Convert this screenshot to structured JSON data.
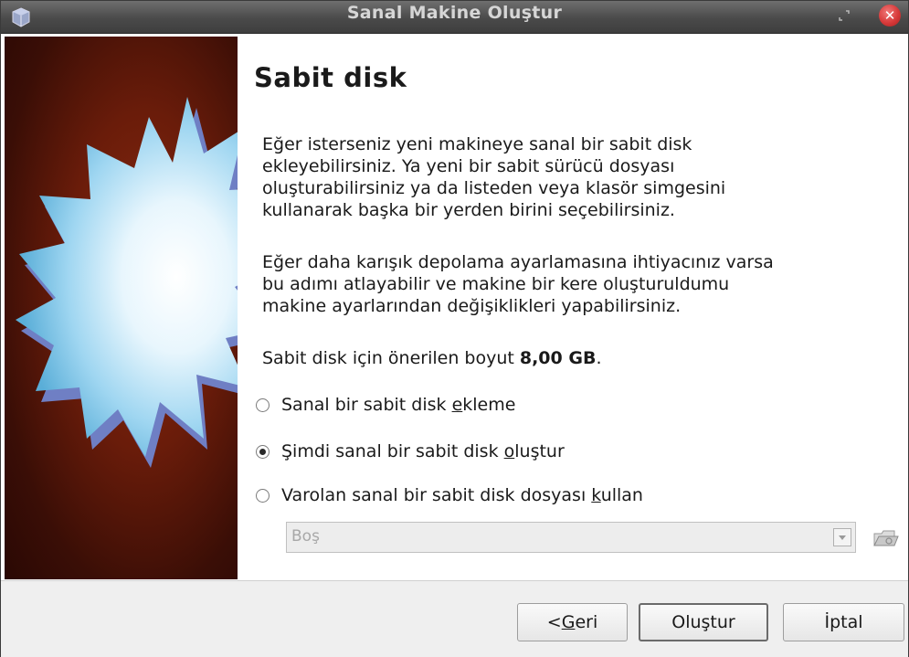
{
  "window": {
    "title": "Sanal Makine Oluştur"
  },
  "page": {
    "title": "Sabit disk",
    "paragraph1": "Eğer isterseniz yeni makineye sanal bir sabit disk\nekleyebilirsiniz. Ya yeni bir sabit sürücü dosyası\noluşturabilirsiniz ya da listeden veya klasör simgesini\nkullanarak başka bir yerden birini seçebilirsiniz.",
    "paragraph2": "Eğer daha karışık depolama ayarlamasına ihtiyacınız varsa\nbu adımı atlayabilir ve makine bir kere oluşturuldumu\nmakine ayarlarından değişiklikleri yapabilirsiniz.",
    "size_prefix": "Sabit disk için önerilen boyut ",
    "size_value": "8,00 GB",
    "size_suffix": "."
  },
  "options": {
    "no_disk": {
      "pre": "Sanal bir sabit disk ",
      "mnemonic": "e",
      "post": "kleme",
      "checked": false
    },
    "create_disk": {
      "pre": "Şimdi sanal bir sabit disk ",
      "mnemonic": "o",
      "post": "luştur",
      "checked": true
    },
    "existing_disk": {
      "pre": "Varolan sanal bir sabit disk dosyası ",
      "mnemonic": "k",
      "post": "ullan",
      "checked": false
    }
  },
  "existing_disk_combo": {
    "value": "Boş",
    "enabled": false
  },
  "buttons": {
    "back_pre": "< ",
    "back_mnemonic": "G",
    "back_post": "eri",
    "create": "Oluştur",
    "cancel": "İptal"
  },
  "icons": {
    "app": "virtualbox-icon",
    "restore": "restore-icon",
    "close": "close-icon",
    "folder": "open-folder-icon",
    "dropdown": "chevron-down-icon"
  },
  "colors": {
    "titlebar": "#4a4a4a",
    "banner_background": "#6a1c0a",
    "close_button": "#d73a3a"
  }
}
